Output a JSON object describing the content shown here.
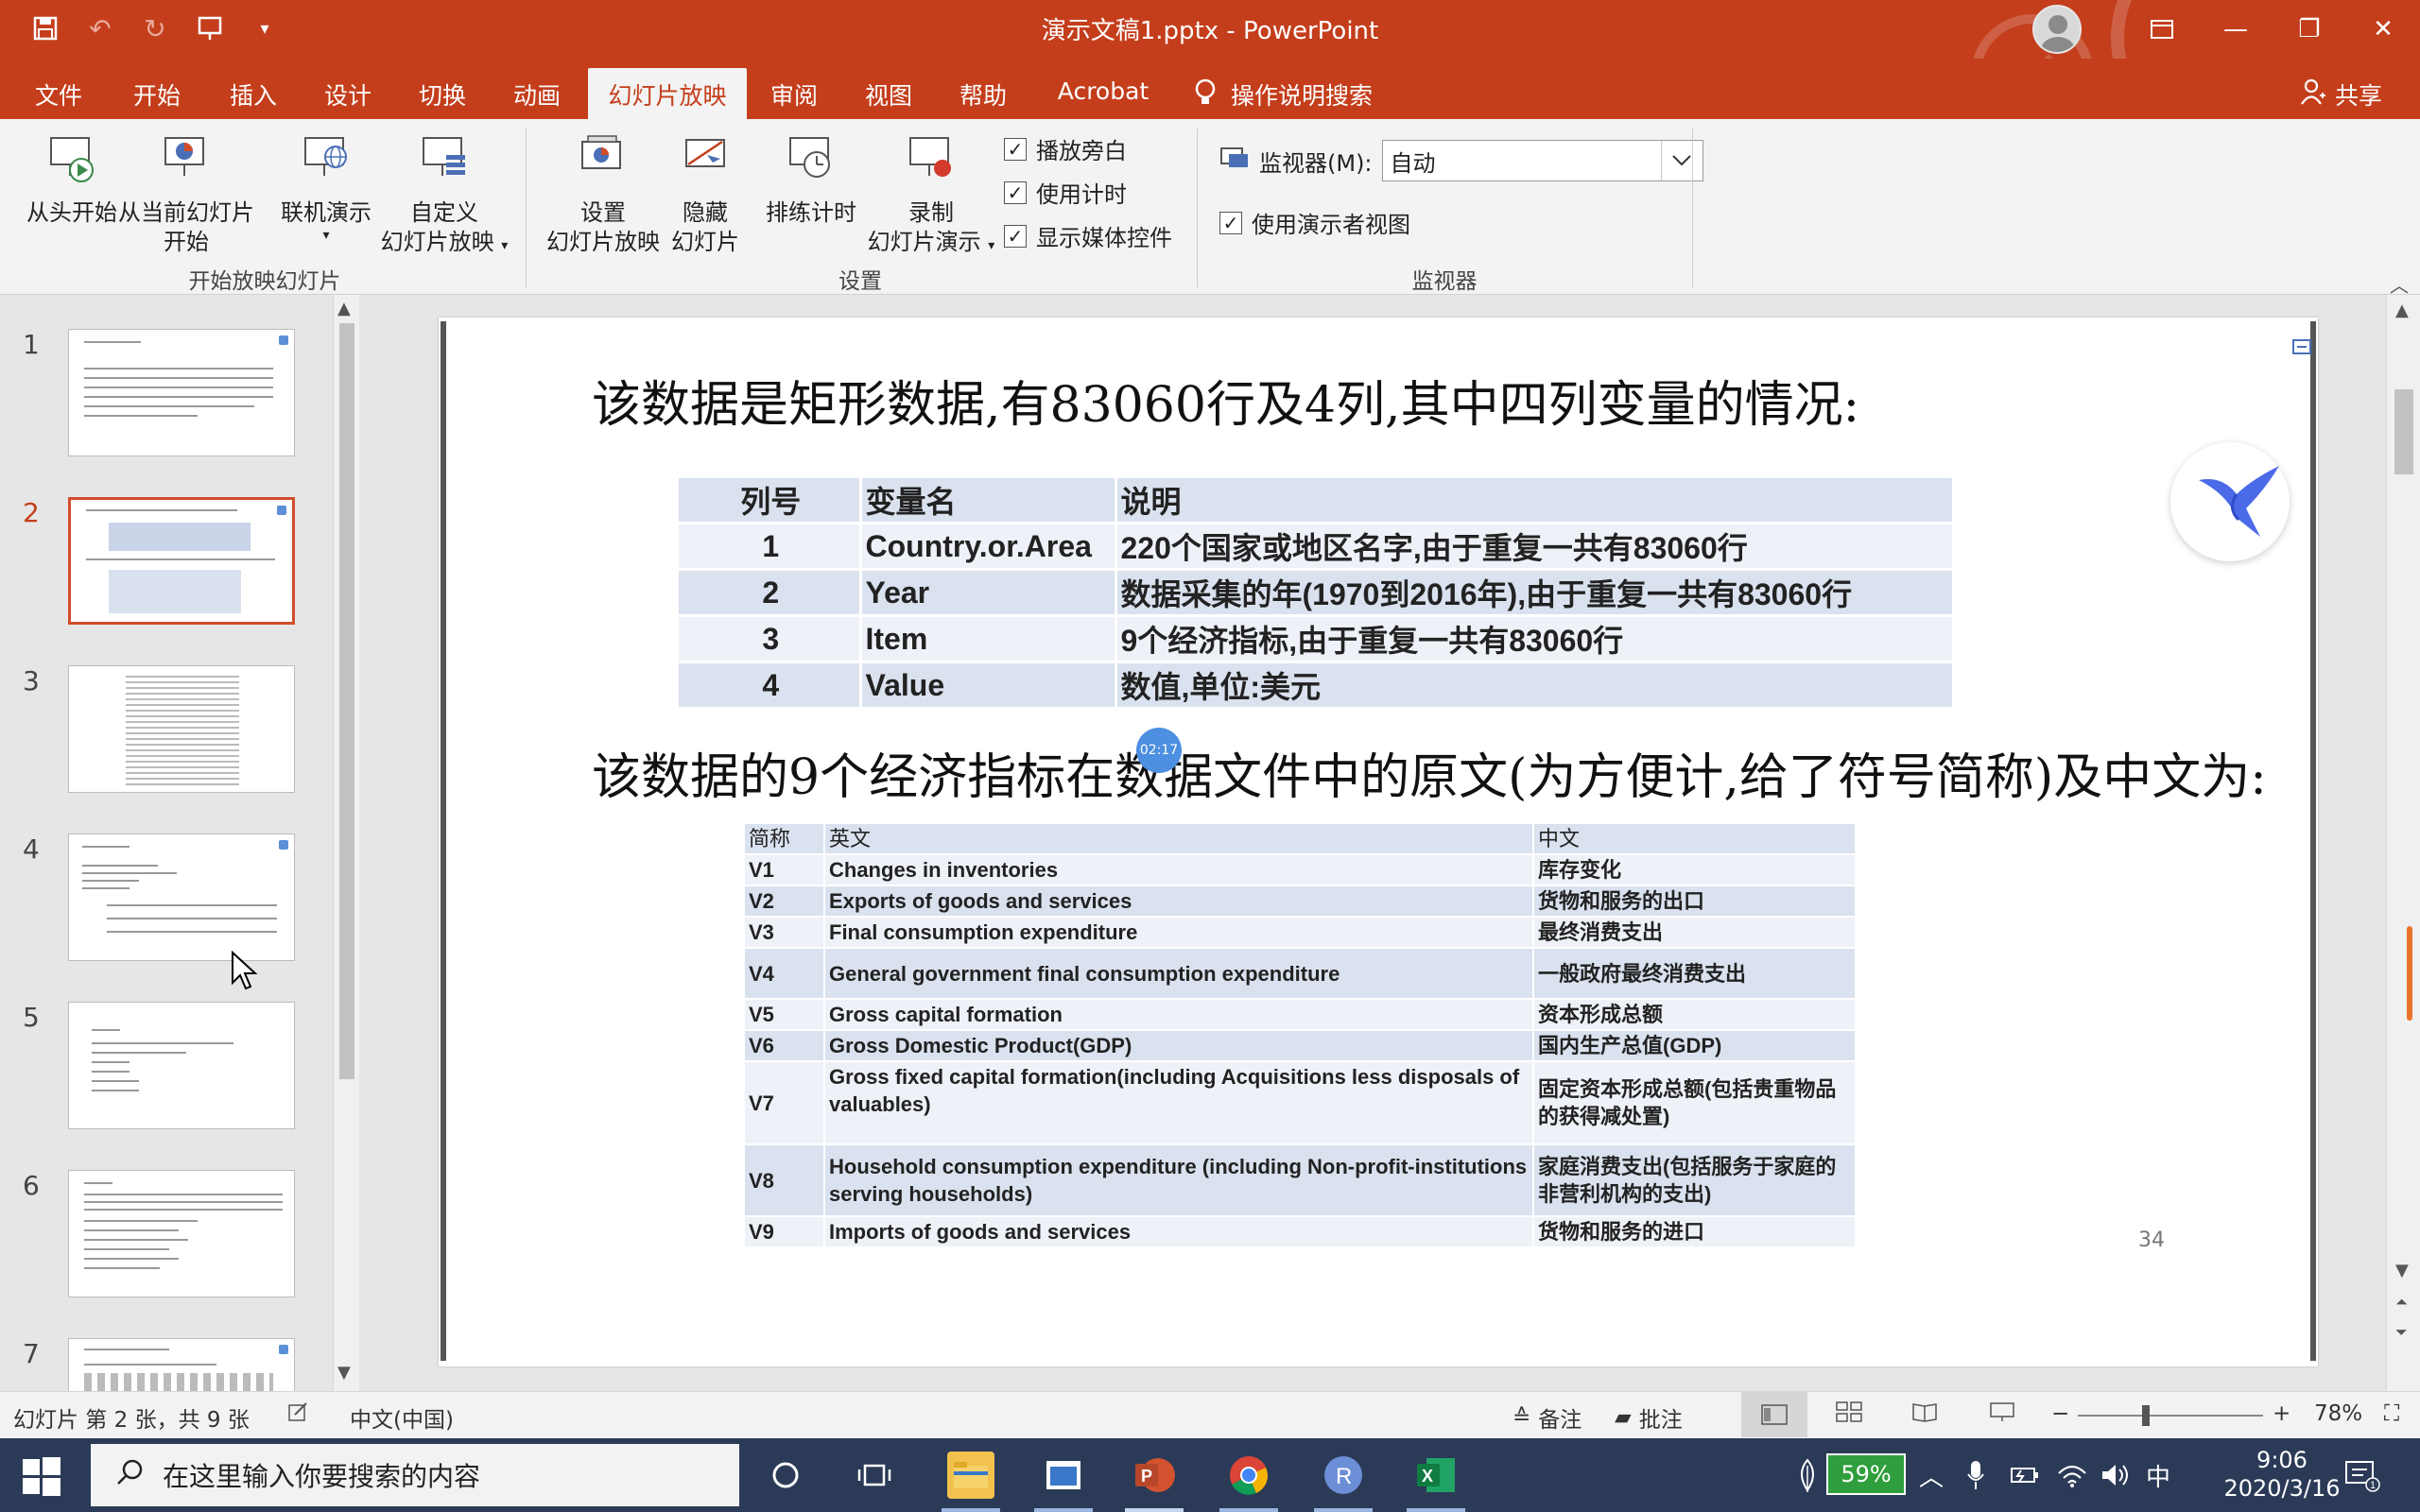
{
  "titlebar": {
    "doc_title": "演示文稿1.pptx  -  PowerPoint"
  },
  "tabs": [
    {
      "label": "文件"
    },
    {
      "label": "开始"
    },
    {
      "label": "插入"
    },
    {
      "label": "设计"
    },
    {
      "label": "切换"
    },
    {
      "label": "动画"
    },
    {
      "label": "幻灯片放映"
    },
    {
      "label": "审阅"
    },
    {
      "label": "视图"
    },
    {
      "label": "帮助"
    },
    {
      "label": "Acrobat"
    }
  ],
  "tell_me": "操作说明搜索",
  "share": "共享",
  "ribbon": {
    "from_start": "从头开始",
    "from_current_1": "从当前幻灯片",
    "from_current_2": "开始",
    "online_present": "联机演示",
    "custom_1": "自定义",
    "custom_2": "幻灯片放映",
    "group_start": "开始放映幻灯片",
    "setup_1": "设置",
    "setup_2": "幻灯片放映",
    "hide_1": "隐藏",
    "hide_2": "幻灯片",
    "rehearse": "排练计时",
    "record_1": "录制",
    "record_2": "幻灯片演示",
    "chk_narration": "播放旁白",
    "chk_timings": "使用计时",
    "chk_media": "显示媒体控件",
    "group_setup": "设置",
    "monitor_label": "监视器(M):",
    "monitor_value": "自动",
    "chk_presenter": "使用演示者视图",
    "group_monitor": "监视器"
  },
  "thumbnails": [
    {
      "num": "1"
    },
    {
      "num": "2"
    },
    {
      "num": "3"
    },
    {
      "num": "4"
    },
    {
      "num": "5"
    },
    {
      "num": "6"
    },
    {
      "num": "7"
    }
  ],
  "slide": {
    "heading1": "该数据是矩形数据,有83060行及4列,其中四列变量的情况:",
    "table1": {
      "header": [
        "列号",
        "变量名",
        "说明"
      ],
      "rows": [
        [
          "1",
          "Country.or.Area",
          "220个国家或地区名字,由于重复一共有83060行"
        ],
        [
          "2",
          "Year",
          "数据采集的年(1970到2016年),由于重复一共有83060行"
        ],
        [
          "3",
          "Item",
          "9个经济指标,由于重复一共有83060行"
        ],
        [
          "4",
          "Value",
          "数值,单位:美元"
        ]
      ]
    },
    "heading2": "该数据的9个经济指标在数据文件中的原文(为方便计,给了符号简称)及中文为:",
    "table2": {
      "header": [
        "简称",
        "英文",
        "中文"
      ],
      "rows": [
        [
          "V1",
          "Changes in inventories",
          "库存变化"
        ],
        [
          "V2",
          "Exports of goods and services",
          "货物和服务的出口"
        ],
        [
          "V3",
          "Final consumption expenditure",
          "最终消费支出"
        ],
        [
          "V4",
          "General government final consumption expenditure",
          "一般政府最终消费支出"
        ],
        [
          "V5",
          "Gross capital formation",
          "资本形成总额"
        ],
        [
          "V6",
          "Gross Domestic Product(GDP)",
          "国内生产总值(GDP)"
        ],
        [
          "V7",
          "Gross fixed capital formation(including Acquisitions less disposals of valuables)",
          "固定资本形成总额(包括贵重物品的获得减处置)"
        ],
        [
          "V8",
          "Household consumption expenditure (including Non-profit-institutions serving households)",
          "家庭消费支出(包括服务于家庭的非营利机构的支出)"
        ],
        [
          "V9",
          "Imports of goods and services",
          "货物和服务的进口"
        ]
      ]
    },
    "page_number": "34",
    "timer": "02:17"
  },
  "statusbar": {
    "slide_info": "幻灯片 第 2 张，共 9 张",
    "language": "中文(中国)",
    "notes": "备注",
    "comments": "批注",
    "zoom": "78%"
  },
  "taskbar": {
    "search_placeholder": "在这里输入你要搜索的内容",
    "battery": "59%",
    "ime": "中",
    "time": "9:06",
    "date": "2020/3/16"
  }
}
